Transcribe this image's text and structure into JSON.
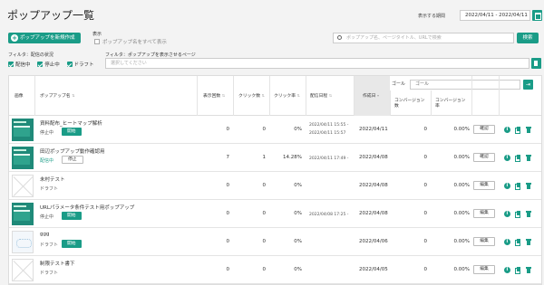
{
  "header": {
    "title": "ポップアップ一覧",
    "period_label": "表示する期間",
    "period_value": "2022/04/11 - 2022/04/11"
  },
  "toolbar": {
    "create_label": "ポップアップを新規作成",
    "display_label": "表示",
    "show_all_label": "ポップアップ名をすべて表示",
    "search_placeholder": "ポップアップ名、ページタイトル、URLで検索",
    "search_button": "検索"
  },
  "filters": {
    "status_label": "フィルタ：配信の状況",
    "page_label": "フィルタ：ポップアップを表示させるページ",
    "page_placeholder": "選択してください",
    "statuses": [
      "配信中",
      "停止中",
      "ドラフト"
    ]
  },
  "table": {
    "columns": {
      "image": "画像",
      "name": "ポップアップ名",
      "views": "表示回数",
      "clicks": "クリック数",
      "ctr": "クリック率",
      "period": "配信日程",
      "created": "作成日",
      "goal_label": "ゴール",
      "goal_value": "ゴール",
      "conv_count": "コンバージョン数",
      "conv_rate": "コンバージョン率"
    },
    "rows": [
      {
        "thumb": "green",
        "name": "資料配布_ヒートマップ解析",
        "status": "停止中",
        "status_class": "",
        "toggle": "開始",
        "toggle_class": "start",
        "views": "0",
        "clicks": "0",
        "ctr": "0%",
        "date1": "2022/04/11 15:55 -",
        "date2": "2022/04/11 15:57",
        "created": "2022/04/11",
        "conv": "0",
        "rate": "0.00%",
        "edit": "確認"
      },
      {
        "thumb": "green",
        "name": "田辺ポップアップ動作確認用",
        "status": "配信中",
        "status_class": "live",
        "toggle": "停止",
        "toggle_class": "stop",
        "views": "7",
        "clicks": "1",
        "ctr": "14.28%",
        "date1": "2022/04/11 17:49 -",
        "date2": "",
        "created": "2022/04/08",
        "conv": "0",
        "rate": "0.00%",
        "edit": "確認"
      },
      {
        "thumb": "empty",
        "name": "未村テスト",
        "status": "ドラフト",
        "status_class": "",
        "toggle": "",
        "toggle_class": "",
        "views": "0",
        "clicks": "0",
        "ctr": "0%",
        "date1": "",
        "date2": "",
        "created": "2022/04/08",
        "conv": "0",
        "rate": "0.00%",
        "edit": "編集"
      },
      {
        "thumb": "green",
        "name": "URLパラメータ条件テスト用ポップアップ",
        "status": "停止中",
        "status_class": "",
        "toggle": "開始",
        "toggle_class": "start",
        "views": "0",
        "clicks": "0",
        "ctr": "0%",
        "date1": "2022/04/08 17:25 -",
        "date2": "",
        "created": "2022/04/08",
        "conv": "0",
        "rate": "0.00%",
        "edit": "編集"
      },
      {
        "thumb": "img",
        "name": "ggg",
        "status": "ドラフト",
        "status_class": "",
        "toggle": "開始",
        "toggle_class": "start",
        "views": "0",
        "clicks": "0",
        "ctr": "0%",
        "date1": "",
        "date2": "",
        "created": "2022/04/06",
        "conv": "0",
        "rate": "0.00%",
        "edit": "編集"
      },
      {
        "thumb": "empty",
        "name": "制限テスト書下",
        "status": "ドラフト",
        "status_class": "",
        "toggle": "",
        "toggle_class": "",
        "views": "0",
        "clicks": "0",
        "ctr": "0%",
        "date1": "",
        "date2": "",
        "created": "2022/04/05",
        "conv": "0",
        "rate": "0.00%",
        "edit": "編集"
      }
    ]
  },
  "colors": {
    "accent": "#1a9c87"
  }
}
